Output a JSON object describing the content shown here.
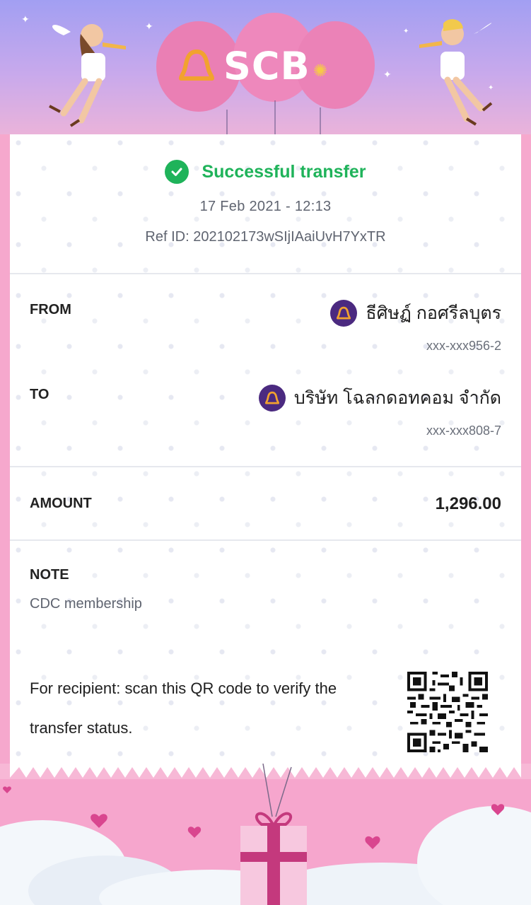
{
  "header": {
    "logo_text": "SCB",
    "logo_icon": "scb-bell-logo-icon",
    "brand_color": "#4b2a80",
    "accent_color": "#ea7fb4"
  },
  "status": {
    "label": "Successful transfer",
    "color": "#1fb35a",
    "icon": "check-circle-icon"
  },
  "datetime": "17 Feb 2021  -  12:13",
  "ref_id": "Ref ID: 202102173wSIjIAaiUvH7YxTR",
  "from": {
    "label": "FROM",
    "name": "ธีศิษฏ์ กอศรีลบุตร",
    "account": "xxx-xxx956-2",
    "icon": "scb-bank-icon"
  },
  "to": {
    "label": "TO",
    "name": "บริษัท โฉลกดอทคอม จำกัด",
    "account": "xxx-xxx808-7",
    "icon": "scb-bank-icon"
  },
  "amount": {
    "label": "AMOUNT",
    "value": "1,296.00"
  },
  "note": {
    "label": "NOTE",
    "value": "CDC membership"
  },
  "qr": {
    "text": "For recipient: scan this QR code to verify the transfer status.",
    "icon": "qr-code-icon"
  }
}
